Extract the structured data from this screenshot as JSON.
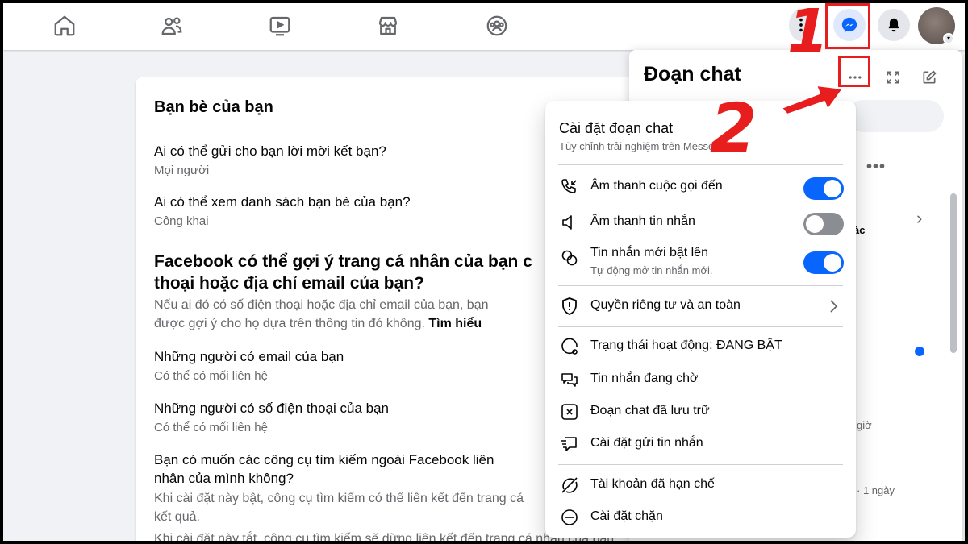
{
  "colors": {
    "accent": "#0866ff",
    "annotation": "#e81e1e",
    "toggle_off": "#8a8d91"
  },
  "nav": {
    "icons": [
      "home-icon",
      "friends-icon",
      "video-icon",
      "marketplace-icon",
      "groups-icon"
    ],
    "right": [
      "menu-dots-icon",
      "messenger-icon",
      "bell-icon",
      "avatar"
    ]
  },
  "privacy": {
    "section_title": "Bạn bè của bạn",
    "q1": {
      "question": "Ai có thể gửi cho bạn lời mời kết bạn?",
      "answer": "Mọi người"
    },
    "q2": {
      "question": "Ai có thể xem danh sách bạn bè của bạn?",
      "answer": "Công khai"
    },
    "heading_line1": "Facebook có thể gợi ý trang cá nhân của bạn c",
    "heading_line2": "thoại hoặc địa chỉ email của bạn?",
    "desc_line1": "Nếu ai đó có số điện thoại hoặc địa chỉ email của bạn, bạn",
    "desc_line2_prefix": "được gợi ý cho họ dựa trên thông tin đó không. ",
    "desc_line2_link": "Tìm hiểu",
    "q3": {
      "question": "Những người có email của bạn",
      "answer": "Có thể có mối liên hệ"
    },
    "q4": {
      "question": "Những người có số điện thoại của bạn",
      "answer": "Có thể có mối liên hệ"
    },
    "q5_line1": "Bạn có muốn các công cụ tìm kiếm ngoài Facebook liên",
    "q5_line2": "nhân của mình không?",
    "q5_desc1": "Khi cài đặt này bật, công cụ tìm kiếm có thể liên kết đến trang cá",
    "q5_desc2": "kết quả.",
    "q5_desc3": "Khi cài đặt này tắt, công cụ tìm kiếm sẽ dừng liên kết đến trang cá nhân của bạn"
  },
  "chat_panel": {
    "title": "Đoạn chat",
    "fragments": {
      "f1": "ác",
      "f2": "giờ",
      "f3": "· 1 ngày"
    }
  },
  "menu": {
    "title": "Cài đặt đoạn chat",
    "subtitle": "Tùy chỉnh trải nghiệm trên Messenger",
    "items": [
      {
        "label": "Âm thanh cuộc gọi đến",
        "icon": "incoming-call-icon",
        "toggle": true
      },
      {
        "label": "Âm thanh tin nhắn",
        "icon": "speaker-icon",
        "toggle": false
      },
      {
        "label": "Tin nhắn mới bật lên",
        "desc": "Tự động mở tin nhắn mới.",
        "icon": "chat-bubbles-icon",
        "toggle": true
      },
      {
        "label": "Quyền riêng tư và an toàn",
        "icon": "shield-icon"
      },
      {
        "label": "Trạng thái hoạt động: ĐANG BẬT",
        "icon": "active-status-icon"
      },
      {
        "label": "Tin nhắn đang chờ",
        "icon": "pending-messages-icon"
      },
      {
        "label": "Đoạn chat đã lưu trữ",
        "icon": "archive-icon"
      },
      {
        "label": "Cài đặt gửi tin nhắn",
        "icon": "message-delivery-icon"
      },
      {
        "label": "Tài khoản đã hạn chế",
        "icon": "restricted-icon"
      },
      {
        "label": "Cài đặt chặn",
        "icon": "block-icon"
      }
    ]
  },
  "annotations": {
    "step1": "1",
    "step2": "2"
  }
}
